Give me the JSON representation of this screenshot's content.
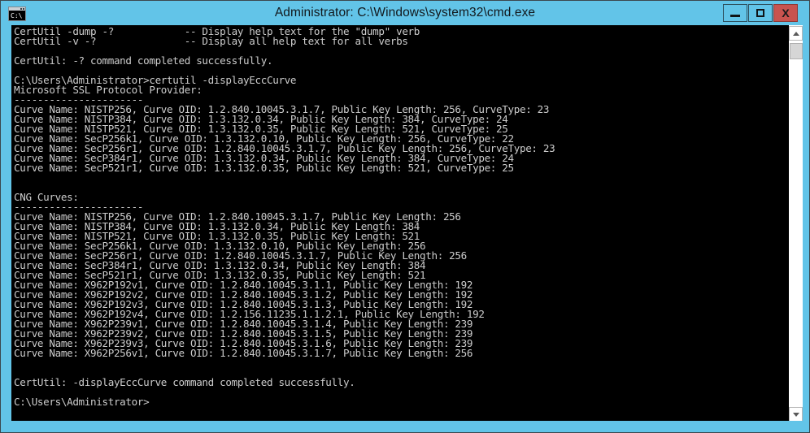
{
  "window": {
    "title": "Administrator: C:\\Windows\\system32\\cmd.exe",
    "icon": "cmd-console-icon",
    "frame_color": "#62c4e8",
    "console_bg": "#000000",
    "console_fg": "#cccccc",
    "buttons": {
      "minimize": "minimize",
      "maximize": "maximize",
      "close": "X"
    }
  },
  "scrollbar": {
    "up_arrow": "scroll-up",
    "down_arrow": "scroll-down",
    "thumb": "scroll-thumb"
  },
  "console": {
    "lines": [
      "CertUtil -dump -?            -- Display help text for the \"dump\" verb",
      "CertUtil -v -?               -- Display all help text for all verbs",
      "",
      "CertUtil: -? command completed successfully.",
      "",
      "C:\\Users\\Administrator>certutil -displayEccCurve",
      "Microsoft SSL Protocol Provider:",
      "----------------------",
      "Curve Name: NISTP256, Curve OID: 1.2.840.10045.3.1.7, Public Key Length: 256, CurveType: 23",
      "Curve Name: NISTP384, Curve OID: 1.3.132.0.34, Public Key Length: 384, CurveType: 24",
      "Curve Name: NISTP521, Curve OID: 1.3.132.0.35, Public Key Length: 521, CurveType: 25",
      "Curve Name: SecP256k1, Curve OID: 1.3.132.0.10, Public Key Length: 256, CurveType: 22",
      "Curve Name: SecP256r1, Curve OID: 1.2.840.10045.3.1.7, Public Key Length: 256, CurveType: 23",
      "Curve Name: SecP384r1, Curve OID: 1.3.132.0.34, Public Key Length: 384, CurveType: 24",
      "Curve Name: SecP521r1, Curve OID: 1.3.132.0.35, Public Key Length: 521, CurveType: 25",
      "",
      "",
      "CNG Curves:",
      "----------------------",
      "Curve Name: NISTP256, Curve OID: 1.2.840.10045.3.1.7, Public Key Length: 256",
      "Curve Name: NISTP384, Curve OID: 1.3.132.0.34, Public Key Length: 384",
      "Curve Name: NISTP521, Curve OID: 1.3.132.0.35, Public Key Length: 521",
      "Curve Name: SecP256k1, Curve OID: 1.3.132.0.10, Public Key Length: 256",
      "Curve Name: SecP256r1, Curve OID: 1.2.840.10045.3.1.7, Public Key Length: 256",
      "Curve Name: SecP384r1, Curve OID: 1.3.132.0.34, Public Key Length: 384",
      "Curve Name: SecP521r1, Curve OID: 1.3.132.0.35, Public Key Length: 521",
      "Curve Name: X962P192v1, Curve OID: 1.2.840.10045.3.1.1, Public Key Length: 192",
      "Curve Name: X962P192v2, Curve OID: 1.2.840.10045.3.1.2, Public Key Length: 192",
      "Curve Name: X962P192v3, Curve OID: 1.2.840.10045.3.1.3, Public Key Length: 192",
      "Curve Name: X962P192v4, Curve OID: 1.2.156.11235.1.1.2.1, Public Key Length: 192",
      "Curve Name: X962P239v1, Curve OID: 1.2.840.10045.3.1.4, Public Key Length: 239",
      "Curve Name: X962P239v2, Curve OID: 1.2.840.10045.3.1.5, Public Key Length: 239",
      "Curve Name: X962P239v3, Curve OID: 1.2.840.10045.3.1.6, Public Key Length: 239",
      "Curve Name: X962P256v1, Curve OID: 1.2.840.10045.3.1.7, Public Key Length: 256",
      "",
      "",
      "CertUtil: -displayEccCurve command completed successfully.",
      "",
      "C:\\Users\\Administrator>"
    ]
  }
}
